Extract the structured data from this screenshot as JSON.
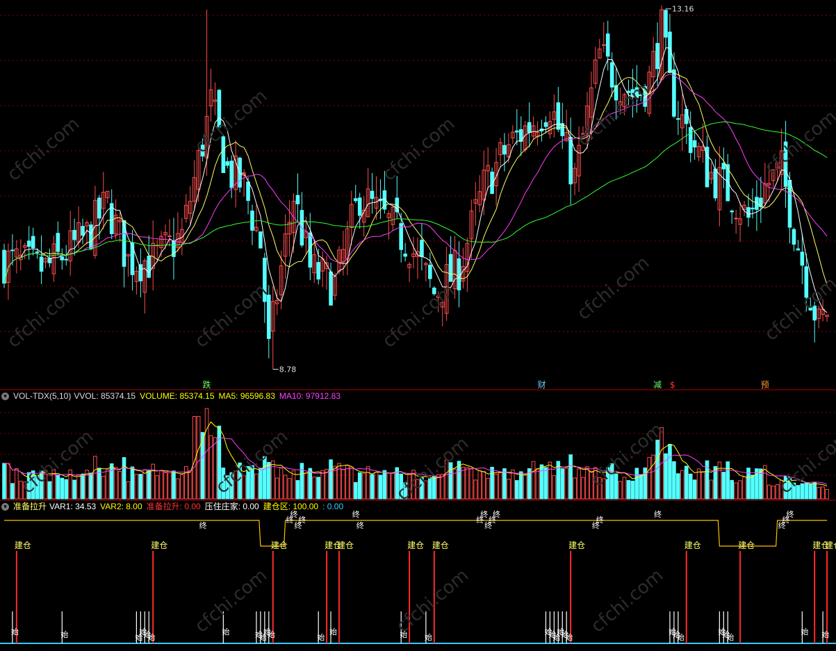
{
  "colors": {
    "up": "#ff4d4d",
    "down": "#54ffff",
    "ma5": "#ffffff",
    "ma10": "#ffff66",
    "ma20": "#ff40ff",
    "ma60": "#33ff33",
    "grid": "#8b0000",
    "panel_line": "#ffc000",
    "build_line": "#ff2a2a"
  },
  "watermark": "cfchi.com",
  "price_panel": {
    "high_label": "13.16",
    "low_label": "8.78",
    "markers": [
      {
        "text": "跌",
        "color": "#66ff66",
        "bar": 49
      },
      {
        "text": "财",
        "color": "#66ccff",
        "bar": 130
      },
      {
        "text": "减",
        "color": "#66ff66",
        "bar": 158
      },
      {
        "text": "$",
        "color": "#ff3333",
        "bar": 162
      },
      {
        "text": "预",
        "color": "#ff9933",
        "bar": 184
      }
    ]
  },
  "volume_panel": {
    "indicator": "VOL-TDX(5,10)",
    "items": [
      {
        "label": "VVOL: 85374.15",
        "color": "#dddddd"
      },
      {
        "label": "VOLUME: 85374.15",
        "color": "#ffff00"
      },
      {
        "label": "MA5: 96596.83",
        "color": "#ffff00"
      },
      {
        "label": "MA10: 97912.83",
        "color": "#ff40ff"
      }
    ]
  },
  "signal_panel": {
    "indicator": "准备拉升",
    "items": [
      {
        "label": "VAR1: 34.53",
        "color": "#ffffff"
      },
      {
        "label": "VAR2: 8.00",
        "color": "#ffff00"
      },
      {
        "label": "准备拉升: 0.00",
        "color": "#ff3333"
      },
      {
        "label": "压住庄家: 0.00",
        "color": "#ffffff"
      },
      {
        "label": "建仓区: 100.00",
        "color": "#ffff00"
      },
      {
        "label": ": 0.00",
        "color": "#33ccff"
      }
    ],
    "build_label": "建仓",
    "start_label": "始",
    "end_label": "终",
    "build_bars": [
      3,
      36,
      65,
      78,
      81,
      98,
      104,
      137,
      165,
      178,
      196,
      199
    ],
    "start_bars": [
      2,
      14,
      32,
      33,
      34,
      35,
      53,
      61,
      62,
      63,
      64,
      76,
      79,
      96,
      102,
      131,
      132,
      133,
      134,
      135,
      136,
      161,
      162,
      163,
      173,
      174,
      175,
      193,
      198
    ],
    "end_bars": [
      48,
      69,
      70,
      71,
      72,
      85,
      86,
      115,
      116,
      117,
      118,
      119,
      143,
      144,
      158,
      188,
      189,
      190
    ],
    "dip_ranges": [
      [
        62,
        67
      ],
      [
        173,
        186
      ]
    ]
  },
  "chart_data": {
    "type": "candlestick",
    "title": "",
    "price_high": 13.16,
    "price_low": 8.78,
    "bar_count": 200,
    "ma_periods": [
      5,
      10,
      20,
      60
    ],
    "volume_last": 85374.15,
    "volume_ma5": 96596.83,
    "volume_ma10": 97912.83,
    "var1": 34.53,
    "var2": 8.0,
    "zone": 100.0
  }
}
